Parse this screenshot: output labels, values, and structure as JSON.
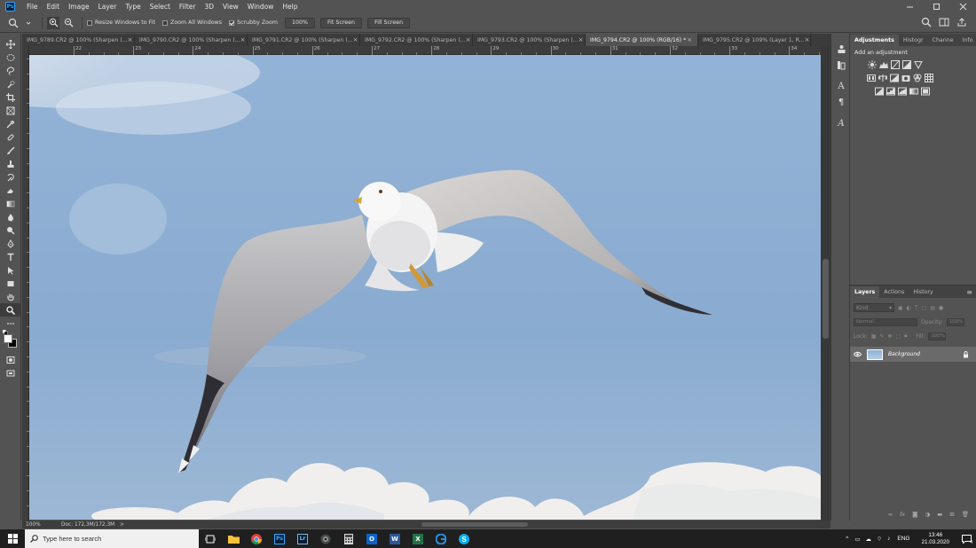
{
  "menubar": {
    "items": [
      "File",
      "Edit",
      "Image",
      "Layer",
      "Type",
      "Select",
      "Filter",
      "3D",
      "View",
      "Window",
      "Help"
    ]
  },
  "options": {
    "resize_windows": "Resize Windows to Fit",
    "zoom_all": "Zoom All Windows",
    "scrubby": "Scrubby Zoom",
    "zoom_100": "100%",
    "fit_screen": "Fit Screen",
    "fill_screen": "Fill Screen"
  },
  "tabs": [
    {
      "label": "IMG_9789.CR2 @ 100% (Sharpen (...",
      "active": false
    },
    {
      "label": "IMG_9790.CR2 @ 100% (Sharpen (...",
      "active": false
    },
    {
      "label": "IMG_9791.CR2 @ 100% (Sharpen (...",
      "active": false
    },
    {
      "label": "IMG_9792.CR2 @ 100% (Sharpen (...",
      "active": false
    },
    {
      "label": "IMG_9793.CR2 @ 100% (Sharpen (...",
      "active": false
    },
    {
      "label": "IMG_9794.CR2 @ 100% (RGB/16) *",
      "active": true
    },
    {
      "label": "IMG_9795.CR2 @ 109% (Layer 1, R...",
      "active": false
    }
  ],
  "tab_close": "×",
  "ruler_marks": [
    "22",
    "23",
    "24",
    "25",
    "26",
    "27",
    "28",
    "29",
    "30",
    "31",
    "32",
    "33",
    "34"
  ],
  "status": {
    "zoom": "100%",
    "doc": "Doc: 172,3M/172,3M"
  },
  "adjustments_panel": {
    "tabs": [
      "Adjustments",
      "Histogr",
      "Channe",
      "Info"
    ],
    "title": "Add an adjustment"
  },
  "layers_panel": {
    "tabs": [
      "Layers",
      "Actions",
      "History"
    ],
    "kind_placeholder": "Kind",
    "blend_mode": "Normal",
    "opacity_label": "Opacity:",
    "opacity_value": "100%",
    "lock_label": "Lock:",
    "fill_label": "Fill:",
    "fill_value": "100%",
    "layer_name": "Background"
  },
  "taskbar": {
    "search_placeholder": "Type here to search",
    "language": "ENG",
    "time": "13:46",
    "date": "21.03.2020",
    "notification_count": "4"
  },
  "colors": {
    "ps_blue": "#31a8ff",
    "ui_gray": "#535353",
    "sky": "#8fb1d5"
  }
}
